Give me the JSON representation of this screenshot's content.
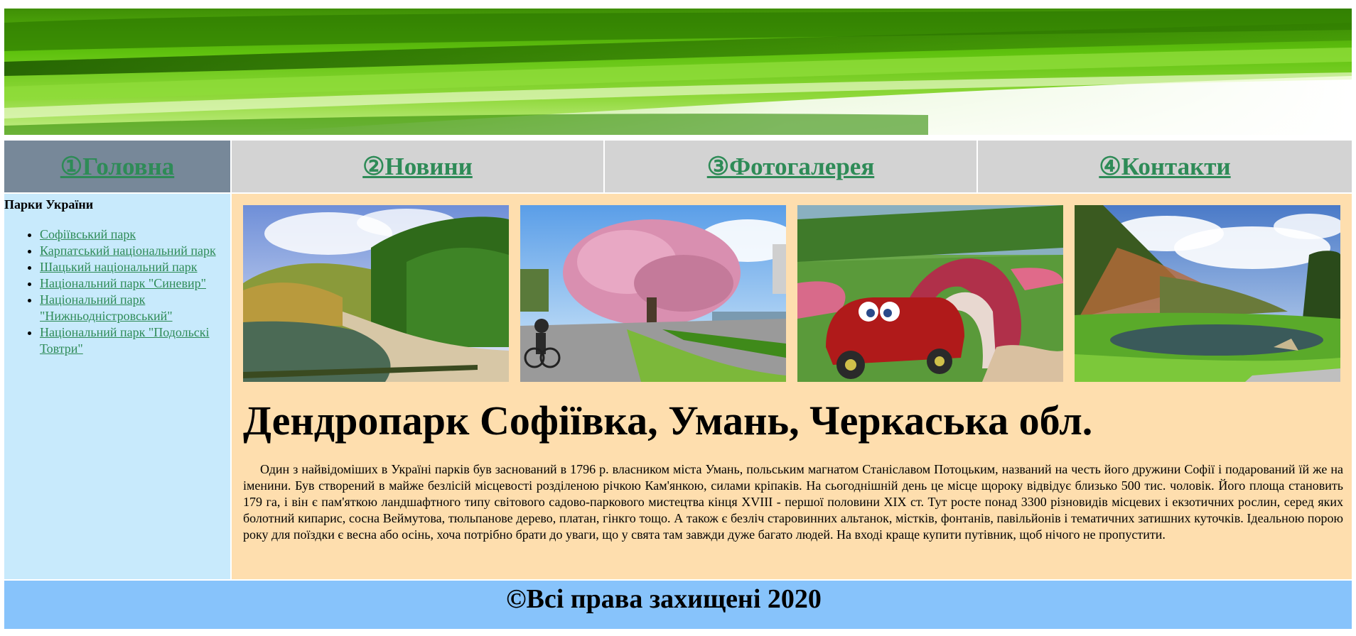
{
  "nav": {
    "items": [
      {
        "label": "①Головна",
        "active": true
      },
      {
        "label": "②Новини",
        "active": false
      },
      {
        "label": "③Фотогалерея",
        "active": false
      },
      {
        "label": "④Контакти",
        "active": false
      }
    ]
  },
  "sidebar": {
    "title": "Парки України",
    "items": [
      {
        "label": "Софіївський парк"
      },
      {
        "label": "Карпатський національний парк"
      },
      {
        "label": "Шацький національний парк"
      },
      {
        "label": "Національний парк \"Синевир\""
      },
      {
        "label": "Національний парк \"Нижньодністровський\""
      },
      {
        "label": "Національний парк \"Подольскі Товтри\""
      }
    ]
  },
  "main": {
    "photos": [
      {
        "subject": "park lake with trees and path"
      },
      {
        "subject": "blossoming tree on park walkway with cyclist"
      },
      {
        "subject": "flower sculpture car with arch"
      },
      {
        "subject": "mountain lake in green valley"
      }
    ],
    "title": "Дендропарк Софіївка, Умань, Черкаська обл.",
    "body": "Один з найвідоміших в Україні парків був заснований в 1796 р. власником міста Умань, польським магнатом Станіславом Потоцьким, названий на честь його дружини Софії і подарований їй же на іменини. Був створений в майже безлісій місцевості розділеною річкою Кам'янкою, силами кріпаків. На сьогоднішній день це місце щороку відвідує близько 500 тис. чоловік. Його площа становить 179 га, і він є пам'яткою ландшафтного типу світового садово-паркового мистецтва кінця XVIII - першої половини XIX ст. Тут росте понад 3300 різновидів місцевих і екзотичних рослин, серед яких болотний кипарис, сосна Веймутова, тюльпанове дерево, платан, гінкго тощо. А також є безліч старовинних альтанок, містків, фонтанів, павільйонів і тематичних затишних куточків. Ідеальною порою року для поїздки є весна або осінь, хоча потрібно брати до уваги, що у свята там завжди дуже багато людей. На вході краще купити путівник, щоб нічого не пропустити."
  },
  "footer": {
    "text": "©Всі права захищені 2020"
  },
  "colors": {
    "link": "#2e8b57",
    "nav_bg": "#d3d3d3",
    "nav_active_bg": "#778899",
    "sidebar_bg": "#c8eafc",
    "main_bg": "#fedeae",
    "footer_bg": "#87c3fb"
  }
}
